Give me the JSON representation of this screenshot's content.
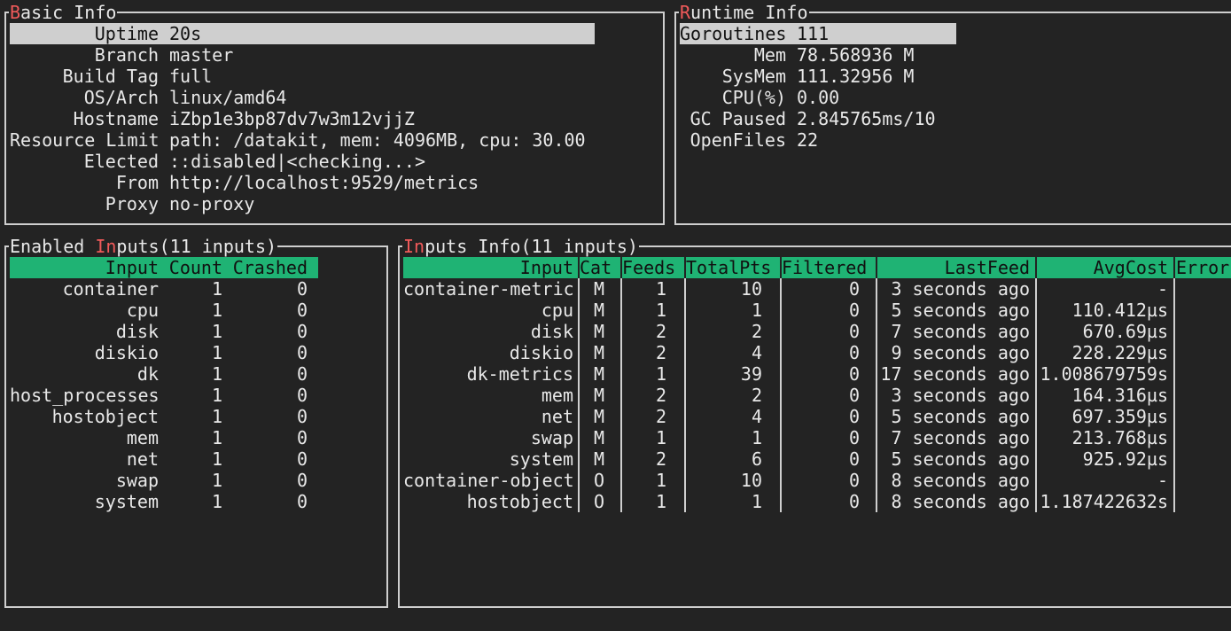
{
  "basic_info": {
    "title_first": "B",
    "title_rest": "asic Info",
    "rows": [
      {
        "label": "Uptime",
        "value": "20s"
      },
      {
        "label": "Branch",
        "value": "master"
      },
      {
        "label": "Build Tag",
        "value": "full"
      },
      {
        "label": "OS/Arch",
        "value": "linux/amd64"
      },
      {
        "label": "Hostname",
        "value": "iZbp1e3bp87dv7w3m12vjjZ"
      },
      {
        "label": "Resource Limit",
        "value": "path: /datakit, mem: 4096MB, cpu: 30.00"
      },
      {
        "label": "Elected",
        "value": "::disabled|<checking...>"
      },
      {
        "label": "From",
        "value": "http://localhost:9529/metrics"
      },
      {
        "label": "Proxy",
        "value": "no-proxy"
      }
    ]
  },
  "runtime_info": {
    "title_first": "R",
    "title_rest": "untime Info",
    "rows": [
      {
        "label": "Goroutines",
        "value": "111"
      },
      {
        "label": "Mem",
        "value": "78.568936 M"
      },
      {
        "label": "SysMem",
        "value": "111.32956 M"
      },
      {
        "label": "CPU(%)",
        "value": "0.00"
      },
      {
        "label": "GC Paused",
        "value": "2.845765ms/10"
      },
      {
        "label": "OpenFiles",
        "value": "22"
      }
    ]
  },
  "enabled_inputs": {
    "title_pre": "Enabled ",
    "title_hl": "In",
    "title_post": "puts(11 inputs)",
    "headers": {
      "input": "Input",
      "count": "Count",
      "crashed": "Crashed"
    },
    "rows": [
      {
        "input": "container",
        "count": "1",
        "crashed": "0"
      },
      {
        "input": "cpu",
        "count": "1",
        "crashed": "0"
      },
      {
        "input": "disk",
        "count": "1",
        "crashed": "0"
      },
      {
        "input": "diskio",
        "count": "1",
        "crashed": "0"
      },
      {
        "input": "dk",
        "count": "1",
        "crashed": "0"
      },
      {
        "input": "host_processes",
        "count": "1",
        "crashed": "0"
      },
      {
        "input": "hostobject",
        "count": "1",
        "crashed": "0"
      },
      {
        "input": "mem",
        "count": "1",
        "crashed": "0"
      },
      {
        "input": "net",
        "count": "1",
        "crashed": "0"
      },
      {
        "input": "swap",
        "count": "1",
        "crashed": "0"
      },
      {
        "input": "system",
        "count": "1",
        "crashed": "0"
      }
    ]
  },
  "inputs_info": {
    "title_hl": "In",
    "title_post": "puts Info(11 inputs)",
    "headers": {
      "input": "Input",
      "cat": "Cat",
      "feeds": "Feeds",
      "totalpts": "TotalPts",
      "filtered": "Filtered",
      "lastfeed": "LastFeed",
      "avgcost": "AvgCost",
      "error": "Error"
    },
    "rows": [
      {
        "input": "container-metric",
        "cat": "M",
        "feeds": "1",
        "totalpts": "10",
        "filtered": "0",
        "lastfeed": "3 seconds ago",
        "avgcost": "-"
      },
      {
        "input": "cpu",
        "cat": "M",
        "feeds": "1",
        "totalpts": "1",
        "filtered": "0",
        "lastfeed": "5 seconds ago",
        "avgcost": "110.412µs"
      },
      {
        "input": "disk",
        "cat": "M",
        "feeds": "2",
        "totalpts": "2",
        "filtered": "0",
        "lastfeed": "7 seconds ago",
        "avgcost": "670.69µs"
      },
      {
        "input": "diskio",
        "cat": "M",
        "feeds": "2",
        "totalpts": "4",
        "filtered": "0",
        "lastfeed": "9 seconds ago",
        "avgcost": "228.229µs"
      },
      {
        "input": "dk-metrics",
        "cat": "M",
        "feeds": "1",
        "totalpts": "39",
        "filtered": "0",
        "lastfeed": "17 seconds ago",
        "avgcost": "1.008679759s"
      },
      {
        "input": "mem",
        "cat": "M",
        "feeds": "2",
        "totalpts": "2",
        "filtered": "0",
        "lastfeed": "3 seconds ago",
        "avgcost": "164.316µs"
      },
      {
        "input": "net",
        "cat": "M",
        "feeds": "2",
        "totalpts": "4",
        "filtered": "0",
        "lastfeed": "5 seconds ago",
        "avgcost": "697.359µs"
      },
      {
        "input": "swap",
        "cat": "M",
        "feeds": "1",
        "totalpts": "1",
        "filtered": "0",
        "lastfeed": "7 seconds ago",
        "avgcost": "213.768µs"
      },
      {
        "input": "system",
        "cat": "M",
        "feeds": "2",
        "totalpts": "6",
        "filtered": "0",
        "lastfeed": "5 seconds ago",
        "avgcost": "925.92µs"
      },
      {
        "input": "container-object",
        "cat": "O",
        "feeds": "1",
        "totalpts": "10",
        "filtered": "0",
        "lastfeed": "8 seconds ago",
        "avgcost": "-"
      },
      {
        "input": "hostobject",
        "cat": "O",
        "feeds": "1",
        "totalpts": "1",
        "filtered": "0",
        "lastfeed": "8 seconds ago",
        "avgcost": "1.187422632s"
      }
    ]
  },
  "colors": {
    "background": "#232323",
    "border": "#cfcfcf",
    "title_highlight": "#f05a5a",
    "header_green": "#1fb374",
    "selected_row": "#cfcfcf",
    "text": "#e8e8e8"
  }
}
